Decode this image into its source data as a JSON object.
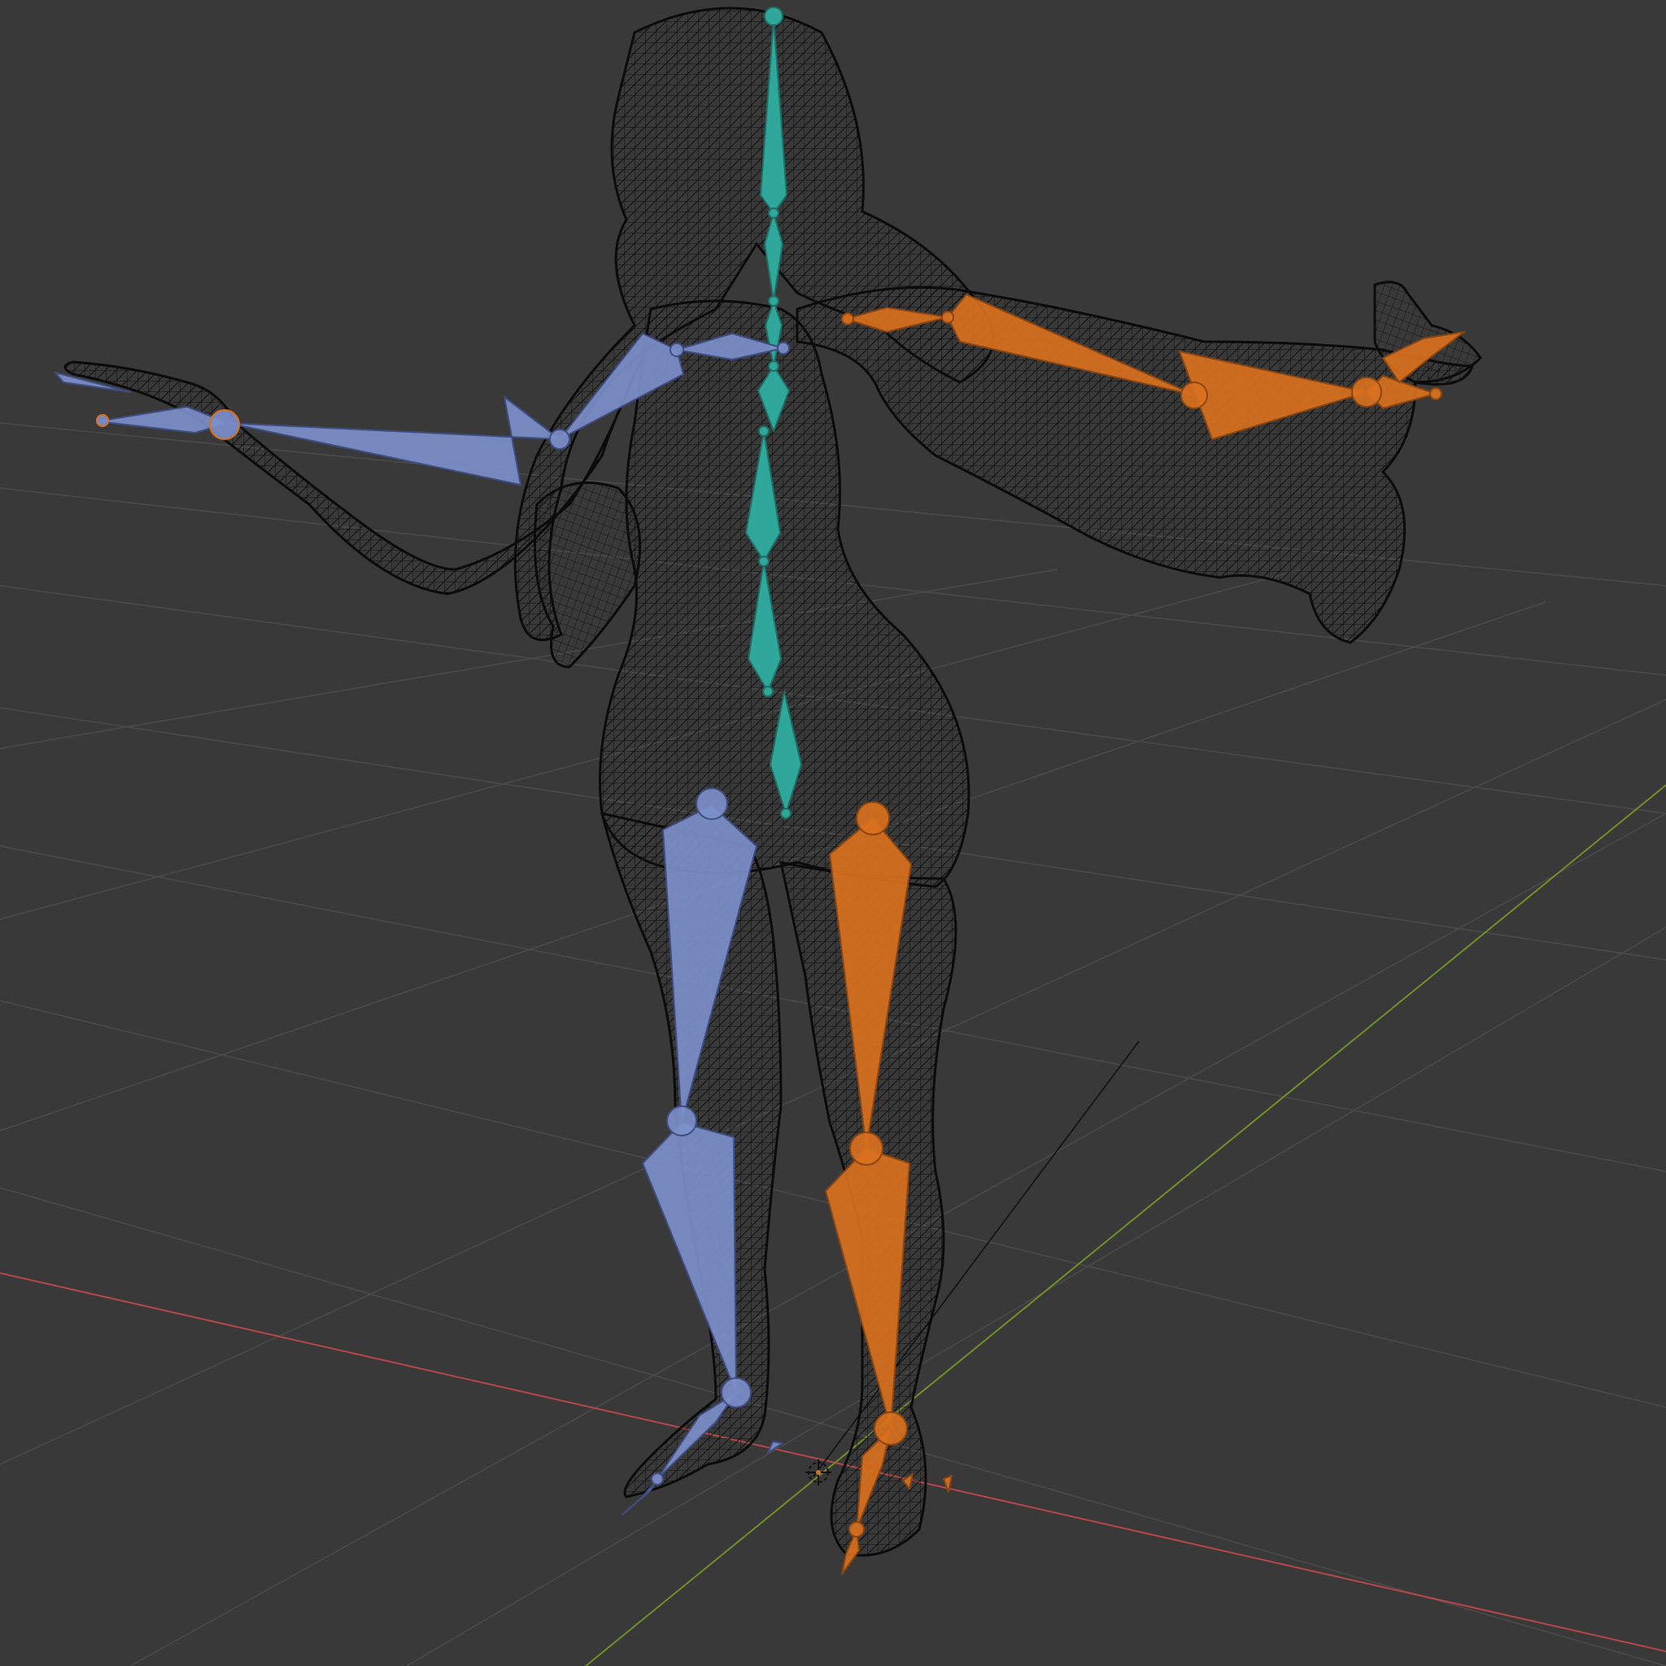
{
  "viewport": {
    "editor": "3D Viewport",
    "display_mode": "wireframe",
    "background_color": "#393939",
    "grid_color": "#4a4a4a",
    "x_axis_color": "#b5474a",
    "y_axis_color": "#6e8f2a"
  },
  "scene": {
    "mesh": {
      "type": "character-mesh",
      "display": "wireframe",
      "wire_color": "#0b0b0b"
    },
    "armature": {
      "bone_display": "octahedral",
      "bone_groups": [
        {
          "group": "center",
          "color": "#2fa79a"
        },
        {
          "group": "left",
          "color": "#7c8fc9"
        },
        {
          "group": "right",
          "color": "#d9711e"
        }
      ],
      "bones": [
        {
          "id": "head",
          "group": "center"
        },
        {
          "id": "neck-upper",
          "group": "center"
        },
        {
          "id": "neck-lower",
          "group": "center"
        },
        {
          "id": "chest",
          "group": "center"
        },
        {
          "id": "spine-upper",
          "group": "center"
        },
        {
          "id": "spine-lower",
          "group": "center"
        },
        {
          "id": "hips",
          "group": "center"
        },
        {
          "id": "shoulder-l",
          "group": "left"
        },
        {
          "id": "upper-arm-l",
          "group": "left"
        },
        {
          "id": "forearm-l",
          "group": "left"
        },
        {
          "id": "hand-l",
          "group": "left"
        },
        {
          "id": "thigh-l",
          "group": "left"
        },
        {
          "id": "shin-l",
          "group": "left"
        },
        {
          "id": "foot-l",
          "group": "left"
        },
        {
          "id": "toe-l",
          "group": "left"
        },
        {
          "id": "shoulder-r",
          "group": "right"
        },
        {
          "id": "upper-arm-r",
          "group": "right"
        },
        {
          "id": "forearm-r",
          "group": "right"
        },
        {
          "id": "hand-r",
          "group": "right"
        },
        {
          "id": "thigh-r",
          "group": "right"
        },
        {
          "id": "shin-r",
          "group": "right"
        },
        {
          "id": "foot-r",
          "group": "right"
        },
        {
          "id": "toe-r",
          "group": "right"
        }
      ]
    },
    "empty": {
      "type": "3d-cursor"
    }
  }
}
